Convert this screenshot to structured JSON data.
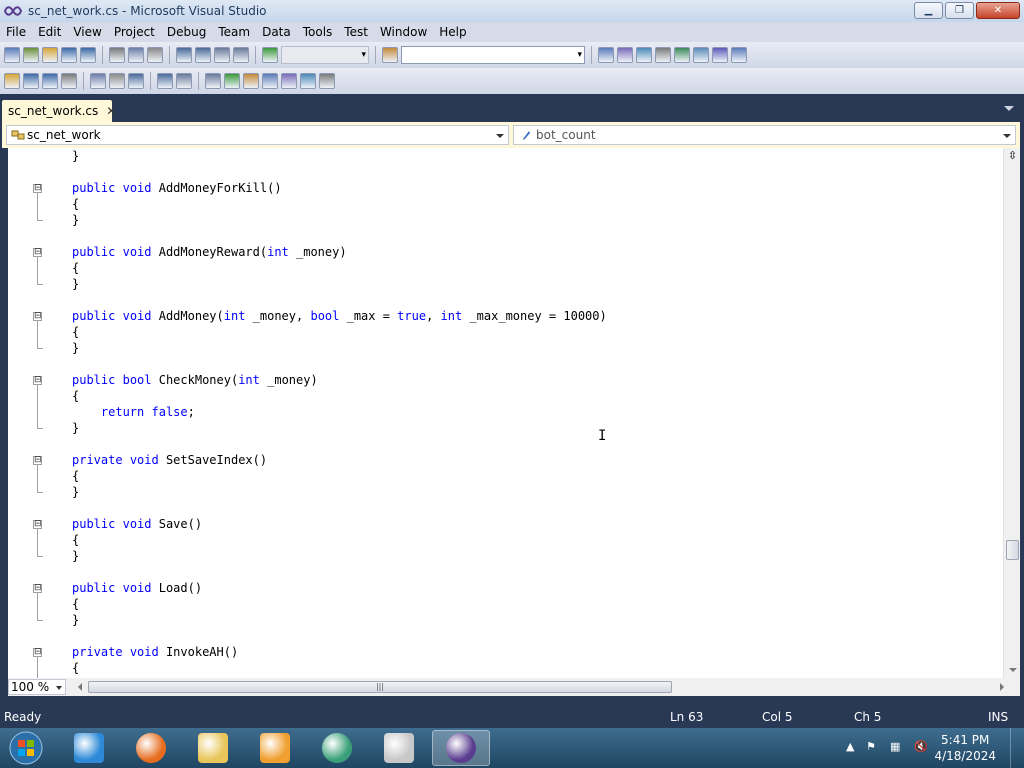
{
  "window": {
    "title": "sc_net_work.cs - Microsoft Visual Studio",
    "controls": {
      "minimize": "▁",
      "restore": "❐",
      "close": "✕"
    }
  },
  "menu": [
    "File",
    "Edit",
    "View",
    "Project",
    "Debug",
    "Team",
    "Data",
    "Tools",
    "Test",
    "Window",
    "Help"
  ],
  "toolbar1": {
    "icons": [
      "new-project-icon",
      "add-item-icon",
      "open-file-icon",
      "save-icon",
      "save-all-icon",
      "cut-icon",
      "copy-icon",
      "paste-icon",
      "undo-icon",
      "redo-icon",
      "navigate-back-icon",
      "navigate-forward-icon",
      "start-debug-icon"
    ],
    "right_icons": [
      "find-icon",
      "solution-explorer-icon",
      "properties-icon",
      "object-browser-icon",
      "toolbox-icon",
      "start-page-icon",
      "extension-icon",
      "window-icon"
    ],
    "config_combo": "",
    "find_combo": ""
  },
  "toolbar2": {
    "icons": [
      "member-list-icon",
      "parameter-info-icon",
      "quick-info-icon",
      "complete-word-icon",
      "format-icon",
      "decrease-indent-icon",
      "increase-indent-icon",
      "comment-icon",
      "uncomment-icon",
      "bookmark-icon",
      "prev-bookmark-icon",
      "next-bookmark-icon",
      "prev-bookmark-folder-icon",
      "next-bookmark-folder-icon",
      "clear-bookmarks-icon",
      "find-in-files-icon"
    ]
  },
  "tab": {
    "label": "sc_net_work.cs",
    "close": "✕"
  },
  "nav": {
    "type": "sc_net_work",
    "member": "bot_count"
  },
  "code_lines": [
    {
      "text": "}",
      "indent": 0
    },
    {
      "blank": true
    },
    {
      "parts": [
        [
          "kw",
          "public"
        ],
        [
          "t",
          " "
        ],
        [
          "kw",
          "void"
        ],
        [
          "t",
          " AddMoneyForKill()"
        ]
      ],
      "collapse": true
    },
    {
      "text": "{"
    },
    {
      "text": "}"
    },
    {
      "blank": true
    },
    {
      "parts": [
        [
          "kw",
          "public"
        ],
        [
          "t",
          " "
        ],
        [
          "kw",
          "void"
        ],
        [
          "t",
          " AddMoneyReward("
        ],
        [
          "kw",
          "int"
        ],
        [
          "t",
          " _money)"
        ]
      ],
      "collapse": true
    },
    {
      "text": "{"
    },
    {
      "text": "}"
    },
    {
      "blank": true
    },
    {
      "parts": [
        [
          "kw",
          "public"
        ],
        [
          "t",
          " "
        ],
        [
          "kw",
          "void"
        ],
        [
          "t",
          " AddMoney("
        ],
        [
          "kw",
          "int"
        ],
        [
          "t",
          " _money, "
        ],
        [
          "kw",
          "bool"
        ],
        [
          "t",
          " _max = "
        ],
        [
          "kw",
          "true"
        ],
        [
          "t",
          ", "
        ],
        [
          "kw",
          "int"
        ],
        [
          "t",
          " _max_money = 10000)"
        ]
      ],
      "collapse": true
    },
    {
      "text": "{"
    },
    {
      "text": "}"
    },
    {
      "blank": true
    },
    {
      "parts": [
        [
          "kw",
          "public"
        ],
        [
          "t",
          " "
        ],
        [
          "kw",
          "bool"
        ],
        [
          "t",
          " CheckMoney("
        ],
        [
          "kw",
          "int"
        ],
        [
          "t",
          " _money)"
        ]
      ],
      "collapse": true
    },
    {
      "text": "{"
    },
    {
      "parts": [
        [
          "t",
          "    "
        ],
        [
          "kw",
          "return"
        ],
        [
          "t",
          " "
        ],
        [
          "kw",
          "false"
        ],
        [
          "t",
          ";"
        ]
      ]
    },
    {
      "text": "}"
    },
    {
      "blank": true
    },
    {
      "parts": [
        [
          "kw",
          "private"
        ],
        [
          "t",
          " "
        ],
        [
          "kw",
          "void"
        ],
        [
          "t",
          " SetSaveIndex()"
        ]
      ],
      "collapse": true
    },
    {
      "text": "{"
    },
    {
      "text": "}"
    },
    {
      "blank": true
    },
    {
      "parts": [
        [
          "kw",
          "public"
        ],
        [
          "t",
          " "
        ],
        [
          "kw",
          "void"
        ],
        [
          "t",
          " Save()"
        ]
      ],
      "collapse": true
    },
    {
      "text": "{"
    },
    {
      "text": "}"
    },
    {
      "blank": true
    },
    {
      "parts": [
        [
          "kw",
          "public"
        ],
        [
          "t",
          " "
        ],
        [
          "kw",
          "void"
        ],
        [
          "t",
          " Load()"
        ]
      ],
      "collapse": true
    },
    {
      "text": "{"
    },
    {
      "text": "}"
    },
    {
      "blank": true
    },
    {
      "parts": [
        [
          "kw",
          "private"
        ],
        [
          "t",
          " "
        ],
        [
          "kw",
          "void"
        ],
        [
          "t",
          " InvokeAH()"
        ]
      ],
      "collapse": true
    },
    {
      "text": "{"
    }
  ],
  "collapse_glyph": "⊟",
  "editor": {
    "zoom": "100 %",
    "hscroll_grip": "|||",
    "split_glyph": "⇳",
    "cursor_glyph": "I"
  },
  "status": {
    "ready": "Ready",
    "ln": "Ln 63",
    "col": "Col 5",
    "ch": "Ch 5",
    "ins": "INS"
  },
  "taskbar": {
    "apps": [
      "internet-explorer-icon",
      "firefox-icon",
      "file-explorer-icon",
      "media-player-icon",
      "app-icon",
      "notepad-icon",
      "visual-studio-icon"
    ],
    "time": "5:41 PM",
    "date": "4/18/2024"
  },
  "colors": {
    "keyword": "#0000ff",
    "chrome": "#293955",
    "doc_tab": "#fff9d9"
  }
}
